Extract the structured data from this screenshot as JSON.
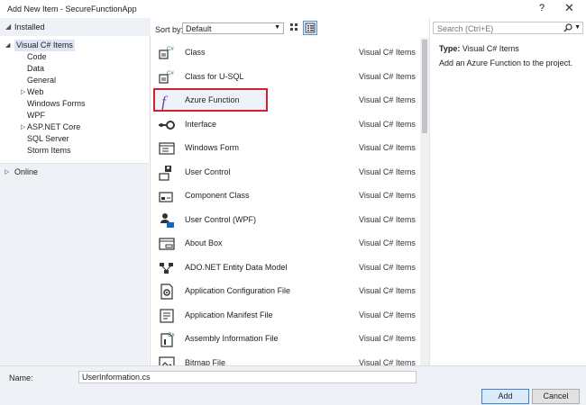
{
  "window": {
    "title": "Add New Item - SecureFunctionApp",
    "help": "?",
    "close": "✕"
  },
  "left": {
    "installed_label": "Installed",
    "online_label": "Online",
    "tree": [
      {
        "label": "Visual C# Items",
        "arrow": "◢",
        "selected": true
      },
      {
        "label": "Code"
      },
      {
        "label": "Data"
      },
      {
        "label": "General"
      },
      {
        "label": "Web",
        "arrow": "▷"
      },
      {
        "label": "Windows Forms"
      },
      {
        "label": "WPF"
      },
      {
        "label": "ASP.NET Core",
        "arrow": "▷"
      },
      {
        "label": "SQL Server"
      },
      {
        "label": "Storm Items"
      }
    ]
  },
  "toolbar": {
    "sort_label": "Sort by:",
    "sort_value": "Default"
  },
  "items": [
    {
      "name": "Class",
      "kind": "Visual C# Items",
      "icon": "class-icon"
    },
    {
      "name": "Class for U-SQL",
      "kind": "Visual C# Items",
      "icon": "usql-class-icon"
    },
    {
      "name": "Azure Function",
      "kind": "Visual C# Items",
      "icon": "azure-function-icon"
    },
    {
      "name": "Interface",
      "kind": "Visual C# Items",
      "icon": "interface-icon"
    },
    {
      "name": "Windows Form",
      "kind": "Visual C# Items",
      "icon": "windows-form-icon"
    },
    {
      "name": "User Control",
      "kind": "Visual C# Items",
      "icon": "user-control-icon"
    },
    {
      "name": "Component Class",
      "kind": "Visual C# Items",
      "icon": "component-class-icon"
    },
    {
      "name": "User Control (WPF)",
      "kind": "Visual C# Items",
      "icon": "user-control-wpf-icon"
    },
    {
      "name": "About Box",
      "kind": "Visual C# Items",
      "icon": "about-box-icon"
    },
    {
      "name": "ADO.NET Entity Data Model",
      "kind": "Visual C# Items",
      "icon": "entity-data-model-icon"
    },
    {
      "name": "Application Configuration File",
      "kind": "Visual C# Items",
      "icon": "config-file-icon"
    },
    {
      "name": "Application Manifest File",
      "kind": "Visual C# Items",
      "icon": "manifest-file-icon"
    },
    {
      "name": "Assembly Information File",
      "kind": "Visual C# Items",
      "icon": "assembly-info-icon"
    },
    {
      "name": "Bitmap File",
      "kind": "Visual C# Items",
      "icon": "bitmap-file-icon"
    }
  ],
  "right": {
    "search_placeholder": "Search (Ctrl+E)",
    "type_label": "Type:",
    "type_value": "Visual C# Items",
    "description": "Add an Azure Function to the project."
  },
  "bottom": {
    "name_label": "Name:",
    "name_value": "UserInformation.cs",
    "add_label": "Add",
    "cancel_label": "Cancel"
  },
  "colors": {
    "accent": "#3c7fd3",
    "highlight_border": "#d2202e",
    "selected_bg": "#dde7f4"
  }
}
